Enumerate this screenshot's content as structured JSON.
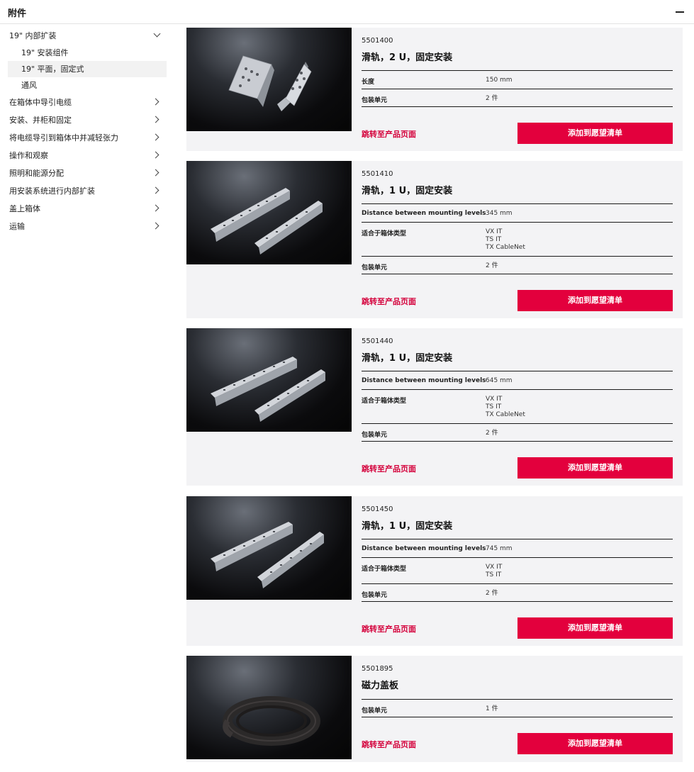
{
  "header": {
    "title": "附件"
  },
  "sidebar": {
    "items": [
      {
        "label": "19\" 内部扩装",
        "expanded": true,
        "children": [
          {
            "label": "19\" 安装组件"
          },
          {
            "label": "19\" 平面，固定式",
            "active": true
          },
          {
            "label": "通风"
          }
        ]
      },
      {
        "label": "在箱体中导引电缆"
      },
      {
        "label": "安装、并柜和固定"
      },
      {
        "label": "将电缆导引到箱体中并减轻张力"
      },
      {
        "label": "操作和观察"
      },
      {
        "label": "照明和能源分配"
      },
      {
        "label": "用安装系统进行内部扩装"
      },
      {
        "label": "盖上箱体"
      },
      {
        "label": "运输"
      }
    ]
  },
  "products": [
    {
      "article": "5501400",
      "title": "滑轨，2 U，固定安装",
      "image": "angle-brackets",
      "specs": [
        {
          "label": "长度",
          "value": "150 mm"
        },
        {
          "label": "包装单元",
          "value": "2 件"
        }
      ]
    },
    {
      "article": "5501410",
      "title": "滑轨，1 U，固定安装",
      "image": "rails",
      "specs": [
        {
          "label": "Distance between mounting levels",
          "value": "345 mm"
        },
        {
          "label": "适合于箱体类型",
          "value": "VX IT\nTS IT\nTX CableNet"
        },
        {
          "label": "包装单元",
          "value": "2 件"
        }
      ]
    },
    {
      "article": "5501440",
      "title": "滑轨，1 U，固定安装",
      "image": "rails",
      "specs": [
        {
          "label": "Distance between mounting levels",
          "value": "645 mm"
        },
        {
          "label": "适合于箱体类型",
          "value": "VX IT\nTS IT\nTX CableNet"
        },
        {
          "label": "包装单元",
          "value": "2 件"
        }
      ]
    },
    {
      "article": "5501450",
      "title": "滑轨，1 U，固定安装",
      "image": "rails",
      "specs": [
        {
          "label": "Distance between mounting levels",
          "value": "745 mm"
        },
        {
          "label": "适合于箱体类型",
          "value": "VX IT\nTS IT"
        },
        {
          "label": "包装单元",
          "value": "2 件"
        }
      ]
    },
    {
      "article": "5501895",
      "title": "磁力盖板",
      "image": "magnetic-strip-roll",
      "specs": [
        {
          "label": "包装单元",
          "value": "1 件"
        }
      ]
    }
  ],
  "labels": {
    "product_link": "跳转至产品页面",
    "add_to_wishlist": "添加到愿望清单"
  },
  "colors": {
    "accent": "#e3003d",
    "link": "#d4003b",
    "card_bg": "#f3f3f5"
  }
}
